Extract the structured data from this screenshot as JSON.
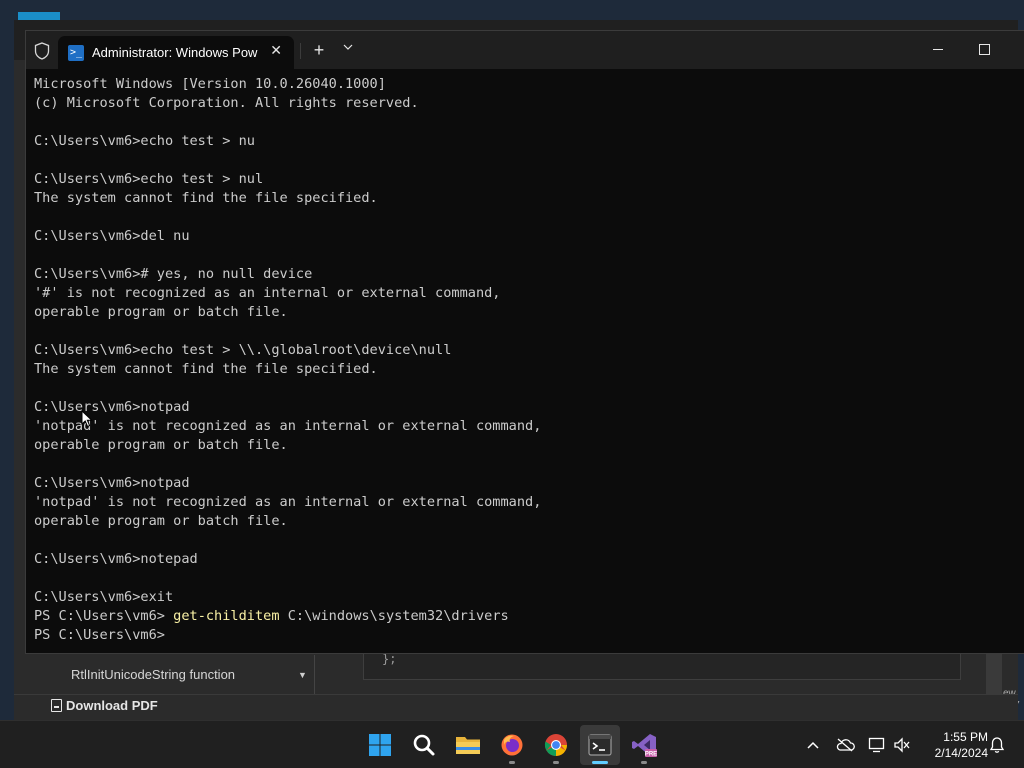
{
  "background_window": {
    "nav_item": "RtlInitUnicodeString function",
    "download_label": "Download PDF",
    "code_fragment": "};",
    "edge_text_1": "ew",
    "edge_text_2": "157"
  },
  "terminal": {
    "tab_title": "Administrator: Windows PowerShell",
    "tab_icon": ">_",
    "close_glyph": "✕",
    "new_tab_glyph": "+",
    "dropdown_glyph": "⌄",
    "lines": [
      {
        "text": "Microsoft Windows [Version 10.0.26040.1000]"
      },
      {
        "text": "(c) Microsoft Corporation. All rights reserved."
      },
      {
        "text": ""
      },
      {
        "text": "C:\\Users\\vm6>echo test > nu"
      },
      {
        "text": ""
      },
      {
        "text": "C:\\Users\\vm6>echo test > nul"
      },
      {
        "text": "The system cannot find the file specified."
      },
      {
        "text": ""
      },
      {
        "text": "C:\\Users\\vm6>del nu"
      },
      {
        "text": ""
      },
      {
        "text": "C:\\Users\\vm6># yes, no null device"
      },
      {
        "text": "'#' is not recognized as an internal or external command,"
      },
      {
        "text": "operable program or batch file."
      },
      {
        "text": ""
      },
      {
        "text": "C:\\Users\\vm6>echo test > \\\\.\\globalroot\\device\\null"
      },
      {
        "text": "The system cannot find the file specified."
      },
      {
        "text": ""
      },
      {
        "text": "C:\\Users\\vm6>notpad"
      },
      {
        "text": "'notpad' is not recognized as an internal or external command,"
      },
      {
        "text": "operable program or batch file."
      },
      {
        "text": ""
      },
      {
        "text": "C:\\Users\\vm6>notpad"
      },
      {
        "text": "'notpad' is not recognized as an internal or external command,"
      },
      {
        "text": "operable program or batch file."
      },
      {
        "text": ""
      },
      {
        "text": "C:\\Users\\vm6>notepad"
      },
      {
        "text": ""
      },
      {
        "text": "C:\\Users\\vm6>exit"
      },
      {
        "prompt": "PS C:\\Users\\vm6> ",
        "command": "get-childitem",
        "args": " C:\\windows\\system32\\drivers"
      },
      {
        "prompt": "PS C:\\Users\\vm6> ",
        "command": "",
        "args": ""
      }
    ]
  },
  "taskbar": {
    "apps": [
      {
        "name": "start-button",
        "icon": "windows-logo-icon"
      },
      {
        "name": "search-button",
        "icon": "search-icon"
      },
      {
        "name": "file-explorer-button",
        "icon": "folder-icon"
      },
      {
        "name": "firefox-button",
        "icon": "firefox-icon"
      },
      {
        "name": "chrome-button",
        "icon": "chrome-icon"
      },
      {
        "name": "terminal-button",
        "icon": "terminal-icon"
      },
      {
        "name": "visual-studio-button",
        "icon": "visual-studio-icon"
      }
    ],
    "time": "1:55 PM",
    "date": "2/14/2024"
  },
  "colors": {
    "terminal_bg": "#0c0c0c",
    "terminal_text": "#cccccc",
    "command_yellow": "#f9f1a5",
    "accent": "#60cdff"
  }
}
